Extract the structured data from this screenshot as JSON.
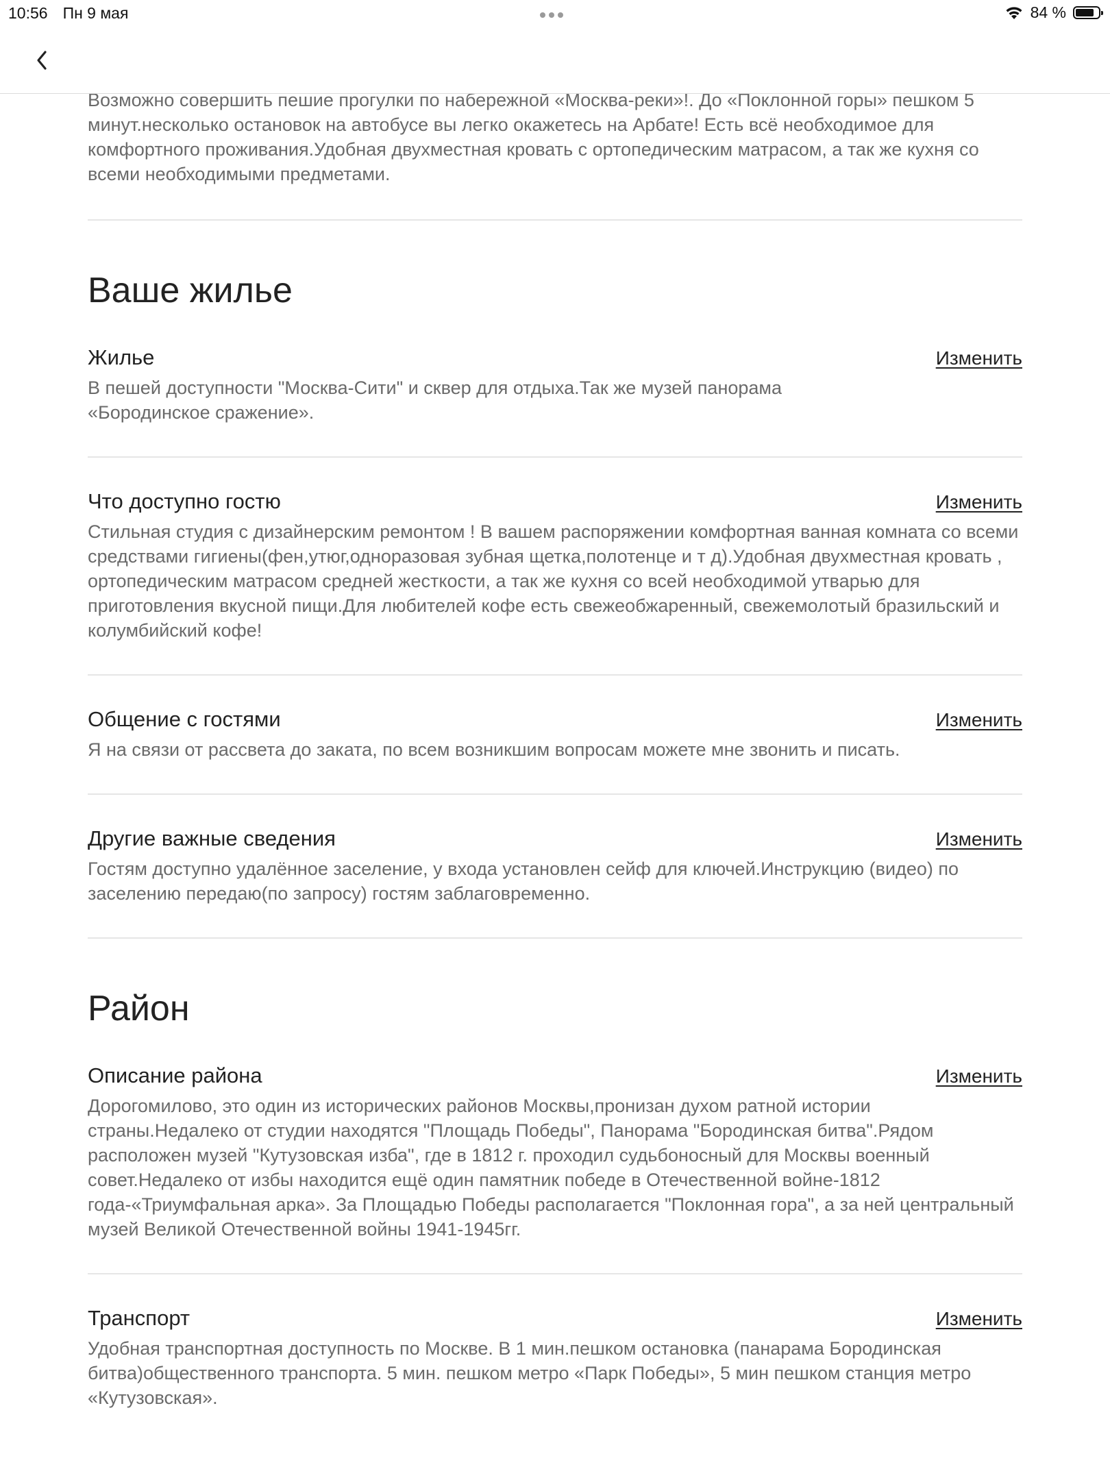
{
  "status_bar": {
    "time": "10:56",
    "date": "Пн 9 мая",
    "battery": "84 %",
    "battery_level": 0.84
  },
  "nav": {
    "back_icon": "chevron-left-icon"
  },
  "intro": {
    "text": "Возможно совершить пешие прогулки по набережной «Москва-реки»!. До «Поклонной  горы» пешком 5 минут.несколько остановок на автобусе вы легко окажетесь на Арбате! Есть всё  необходимое для комфортного проживания.Удобная двухместная кровать с ортопедическим матрасом, а так же кухня со всеми необходимыми предметами."
  },
  "sections": [
    {
      "title": "Ваше жилье",
      "items": [
        {
          "title": "Жилье",
          "edit_label": "Изменить",
          "text": "В пешей доступности \"Москва-Сити\" и сквер для отдыха.Так же музей панорама «Бородинское сражение»."
        },
        {
          "title": "Что доступно гостю",
          "edit_label": "Изменить",
          "text": "Стильная студия с дизайнерским ремонтом ! В вашем распоряжении комфортная ванная комната со всеми средствами гигиены(фен,утюг,одноразовая зубная щетка,полотенце и т д).Удобная двухместная кровать , ортопедическим матрасом средней жесткости, а так же кухня со всей необходимой утварью для приготовления вкусной пищи.Для любителей кофе есть свежеобжаренный, свежемолотый бразильский и колумбийский кофе!"
        },
        {
          "title": "Общение с гостями",
          "edit_label": "Изменить",
          "text": "Я на связи от рассвета до заката, по всем возникшим вопросам можете мне звонить и писать."
        },
        {
          "title": "Другие важные сведения",
          "edit_label": "Изменить",
          "text": "Гостям доступно удалённое заселение, у входа установлен сейф для ключей.Инструкцию (видео) по заселению передаю(по запросу) гостям  заблаговременно."
        }
      ]
    },
    {
      "title": "Район",
      "items": [
        {
          "title": "Описание района",
          "edit_label": "Изменить",
          "text": "Дорогомилово, это один из исторических районов Москвы,пронизан духом ратной истории страны.Недалеко от студии находятся \"Площадь Победы\", Панорама \"Бородинская битва\".Рядом расположен музей \"Кутузовская изба\", где в 1812 г. проходил судьбоносный для Москвы военный совет.Недалеко от избы находится ещё один памятник победе в Отечественной войне-1812 года-«Триумфальная арка». За Площадью Победы располагается  \"Поклонная гора\", а за ней центральный музей Великой Отечественной войны 1941-1945гг."
        },
        {
          "title": "Транспорт",
          "edit_label": "Изменить",
          "text": "Удобная транспортная доступность по Москве. В 1 мин.пешком  остановка (панарама Бородинская битва)общественного транспорта. 5 мин. пешком метро «Парк Победы», 5 мин пешком станция метро «Кутузовская»."
        }
      ]
    }
  ]
}
